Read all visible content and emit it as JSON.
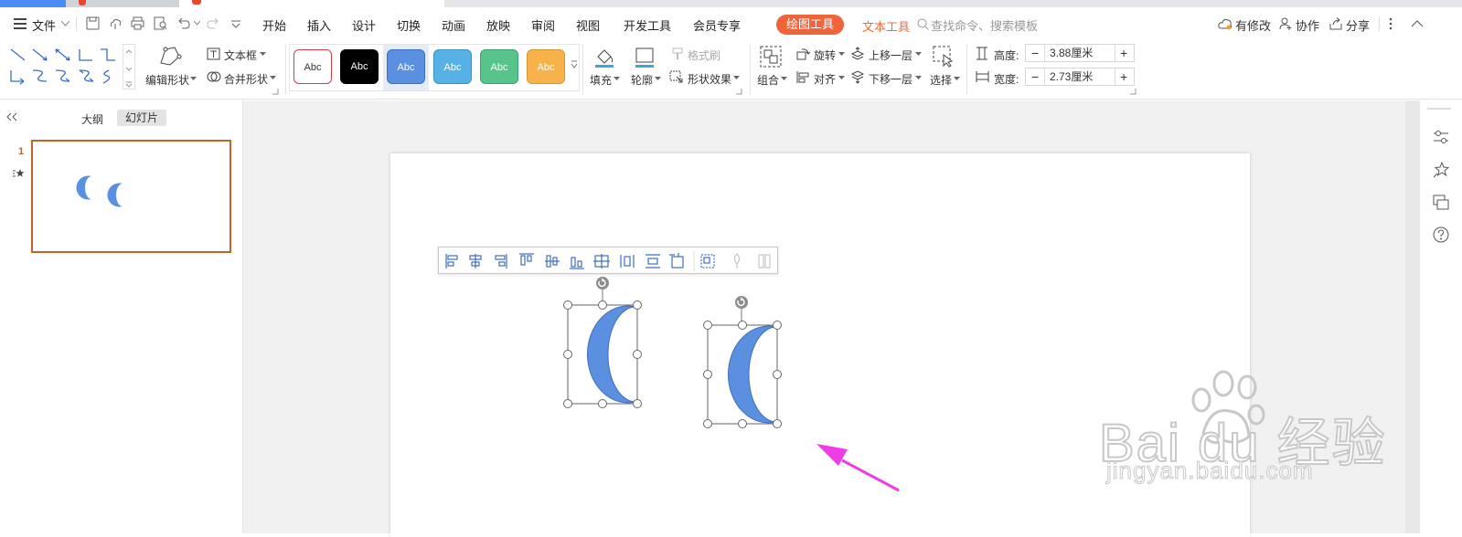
{
  "menu": {
    "file": "文件",
    "tabs": [
      "开始",
      "插入",
      "设计",
      "切换",
      "动画",
      "放映",
      "审阅",
      "视图",
      "开发工具",
      "会员专享"
    ],
    "drawing_tools": "绘图工具",
    "text_tools": "文本工具",
    "search_placeholder": "查找命令、搜索模板",
    "modified": "有修改",
    "collaborate": "协作",
    "share": "分享"
  },
  "ribbon": {
    "edit_shape": "编辑形状",
    "text_box": "文本框",
    "merge_shape": "合并形状",
    "styles": [
      "Abc",
      "Abc",
      "Abc",
      "Abc",
      "Abc",
      "Abc"
    ],
    "format_painter": "格式刷",
    "fill": "填充",
    "outline": "轮廓",
    "shape_effect": "形状效果",
    "group": "组合",
    "rotate": "旋转",
    "align": "对齐",
    "bring_forward": "上移一层",
    "send_backward": "下移一层",
    "select": "选择",
    "height_label": "高度:",
    "height_value": "3.88厘米",
    "width_label": "宽度:",
    "width_value": "2.73厘米"
  },
  "panel": {
    "tab_outline": "大纲",
    "tab_slides": "幻灯片",
    "slide_number": "1"
  },
  "colors": {
    "accent": "#f0643a",
    "shape_fill": "#5b8fe0",
    "arrow": "#ee3ce6",
    "thumb_border": "#c9602a"
  },
  "watermark": {
    "brand": "Bai du 经验",
    "url": "jingyan.baidu.com"
  }
}
